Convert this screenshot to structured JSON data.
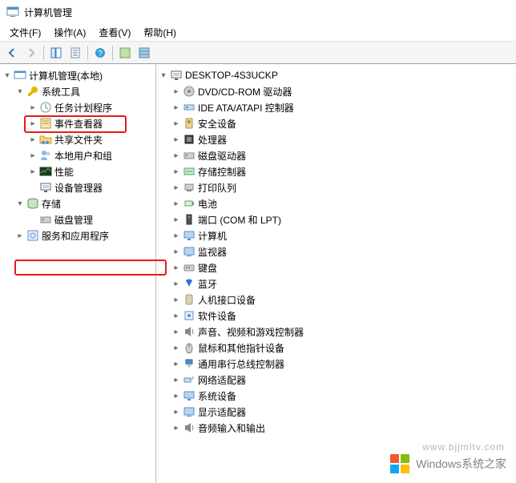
{
  "window": {
    "title": "计算机管理"
  },
  "menus": {
    "file": "文件(F)",
    "action": "操作(A)",
    "view": "查看(V)",
    "help": "帮助(H)"
  },
  "left_tree": {
    "root": "计算机管理(本地)",
    "system_tools": "系统工具",
    "task_scheduler": "任务计划程序",
    "event_viewer": "事件查看器",
    "shared_folders": "共享文件夹",
    "local_users": "本地用户和组",
    "performance": "性能",
    "device_manager": "设备管理器",
    "storage": "存储",
    "disk_management": "磁盘管理",
    "services_apps": "服务和应用程序"
  },
  "right_tree": {
    "root": "DESKTOP-4S3UCKP",
    "items": [
      "DVD/CD-ROM 驱动器",
      "IDE ATA/ATAPI 控制器",
      "安全设备",
      "处理器",
      "磁盘驱动器",
      "存储控制器",
      "打印队列",
      "电池",
      "端口 (COM 和 LPT)",
      "计算机",
      "监视器",
      "键盘",
      "蓝牙",
      "人机接口设备",
      "软件设备",
      "声音、视频和游戏控制器",
      "鼠标和其他指针设备",
      "通用串行总线控制器",
      "网络适配器",
      "系统设备",
      "显示适配器",
      "音频输入和输出"
    ]
  },
  "watermark": {
    "brand": "Windows系统之家",
    "url": "www.bjjmltv.com"
  },
  "highlights": {
    "left_device_manager": true,
    "right_sound": true
  }
}
